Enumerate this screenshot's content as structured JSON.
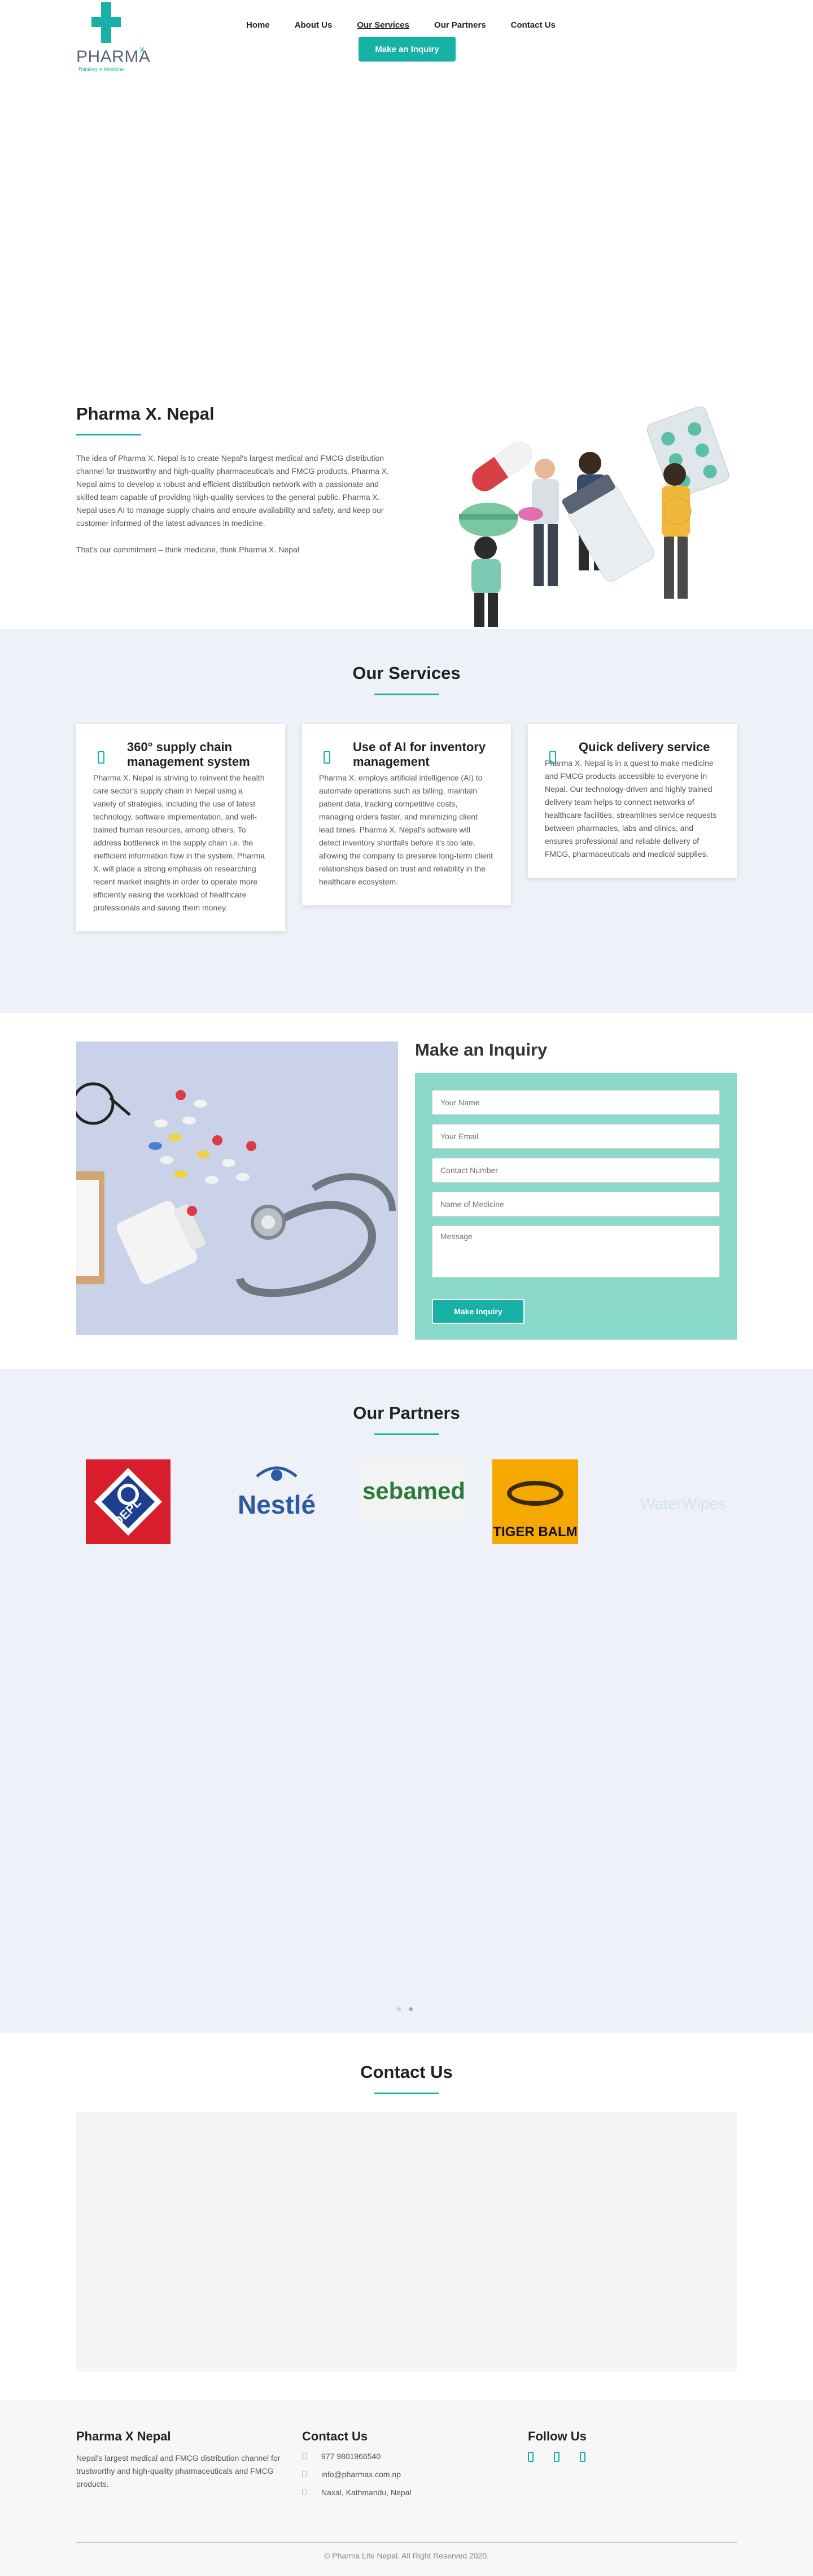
{
  "brand": {
    "name": "PHARMA",
    "superscript": "X",
    "tagline": "Thinking is Medicine",
    "color": "#17b1a6"
  },
  "nav": {
    "items": [
      "Home",
      "About Us",
      "Our Services",
      "Our Partners",
      "Contact Us"
    ],
    "active": "Our Services",
    "cta": "Make an Inquiry"
  },
  "about": {
    "title": "Pharma X. Nepal",
    "paragraph1": "The idea of Pharma X. Nepal is to create Nepal's largest medical and FMCG distribution channel for trustworthy and high-quality pharmaceuticals and FMCG products. Pharma X. Nepal aims to develop a robust and efficient distribution network with a passionate and skilled team capable of providing high-quality services to the general public. Pharma X. Nepal uses AI to manage supply chains and ensure availability and safety, and keep our customer informed of the latest advances in medicine.",
    "paragraph2": "That's our commitment – think medicine, think Pharma X. Nepal"
  },
  "services": {
    "title": "Our Services",
    "cards": [
      {
        "title": "360° supply chain management system",
        "text": "Pharma X. Nepal is striving to reinvent the health care sector's supply chain in Nepal using a variety of strategies, including the use of latest technology, software implementation, and well-trained human resources, among others. To address bottleneck in the supply chain i.e. the inefficient information flow in the system, Pharma X. will place a strong emphasis on researching recent market insights in order to operate more efficiently easing the workload of healthcare professionals and saving them money."
      },
      {
        "title": "Use of AI for inventory management",
        "text": "Pharma X. employs artificial intelligence (AI) to automate operations such as billing, maintain patient data, tracking competitive costs, managing orders faster, and minimizing client lead times. Pharma X. Nepal's software will detect inventory shortfalls before it's too late, allowing the company to preserve long-term client relationships based on trust and reliability in the healthcare ecosystem."
      },
      {
        "title": "Quick delivery service",
        "text": "Pharma X. Nepal is in a quest to make medicine and FMCG products accessible to everyone in Nepal. Our technology-driven and highly trained delivery team helps to connect networks of healthcare facilities, streamlines service requests between pharmacies, labs and clinics, and ensures professional and reliable delivery of FMCG, pharmaceuticals and medical supplies."
      }
    ]
  },
  "inquiry": {
    "title": "Make an Inquiry",
    "fields": {
      "name": "Your Name",
      "email": "Your Email",
      "phone": "Contact Number",
      "medicine": "Name of Medicine",
      "message": "Message"
    },
    "submit": "Make Inquiry"
  },
  "partners": {
    "title": "Our Partners",
    "logos": [
      "DEPL",
      "Nestlé",
      "sebamed",
      "TIGER BALM",
      "WaterWipes"
    ],
    "carousel_pages": 2,
    "carousel_active": 2
  },
  "contact": {
    "title": "Contact Us"
  },
  "footer": {
    "about_title": "Pharma X Nepal",
    "about_text": "Nepal's largest medical and FMCG distribution channel for trustworthy and high-quality pharmaceuticals and FMCG products.",
    "contact_title": "Contact Us",
    "phone": "977 9801966540",
    "email": "info@pharmax.com.np",
    "address": "Naxal, Kathmandu, Nepal",
    "follow_title": "Follow Us",
    "social_icons": [
      "facebook-icon",
      "instagram-icon",
      "linkedin-icon"
    ],
    "copyright": "© Pharma Life Nepal. All Right Reserved 2020."
  }
}
